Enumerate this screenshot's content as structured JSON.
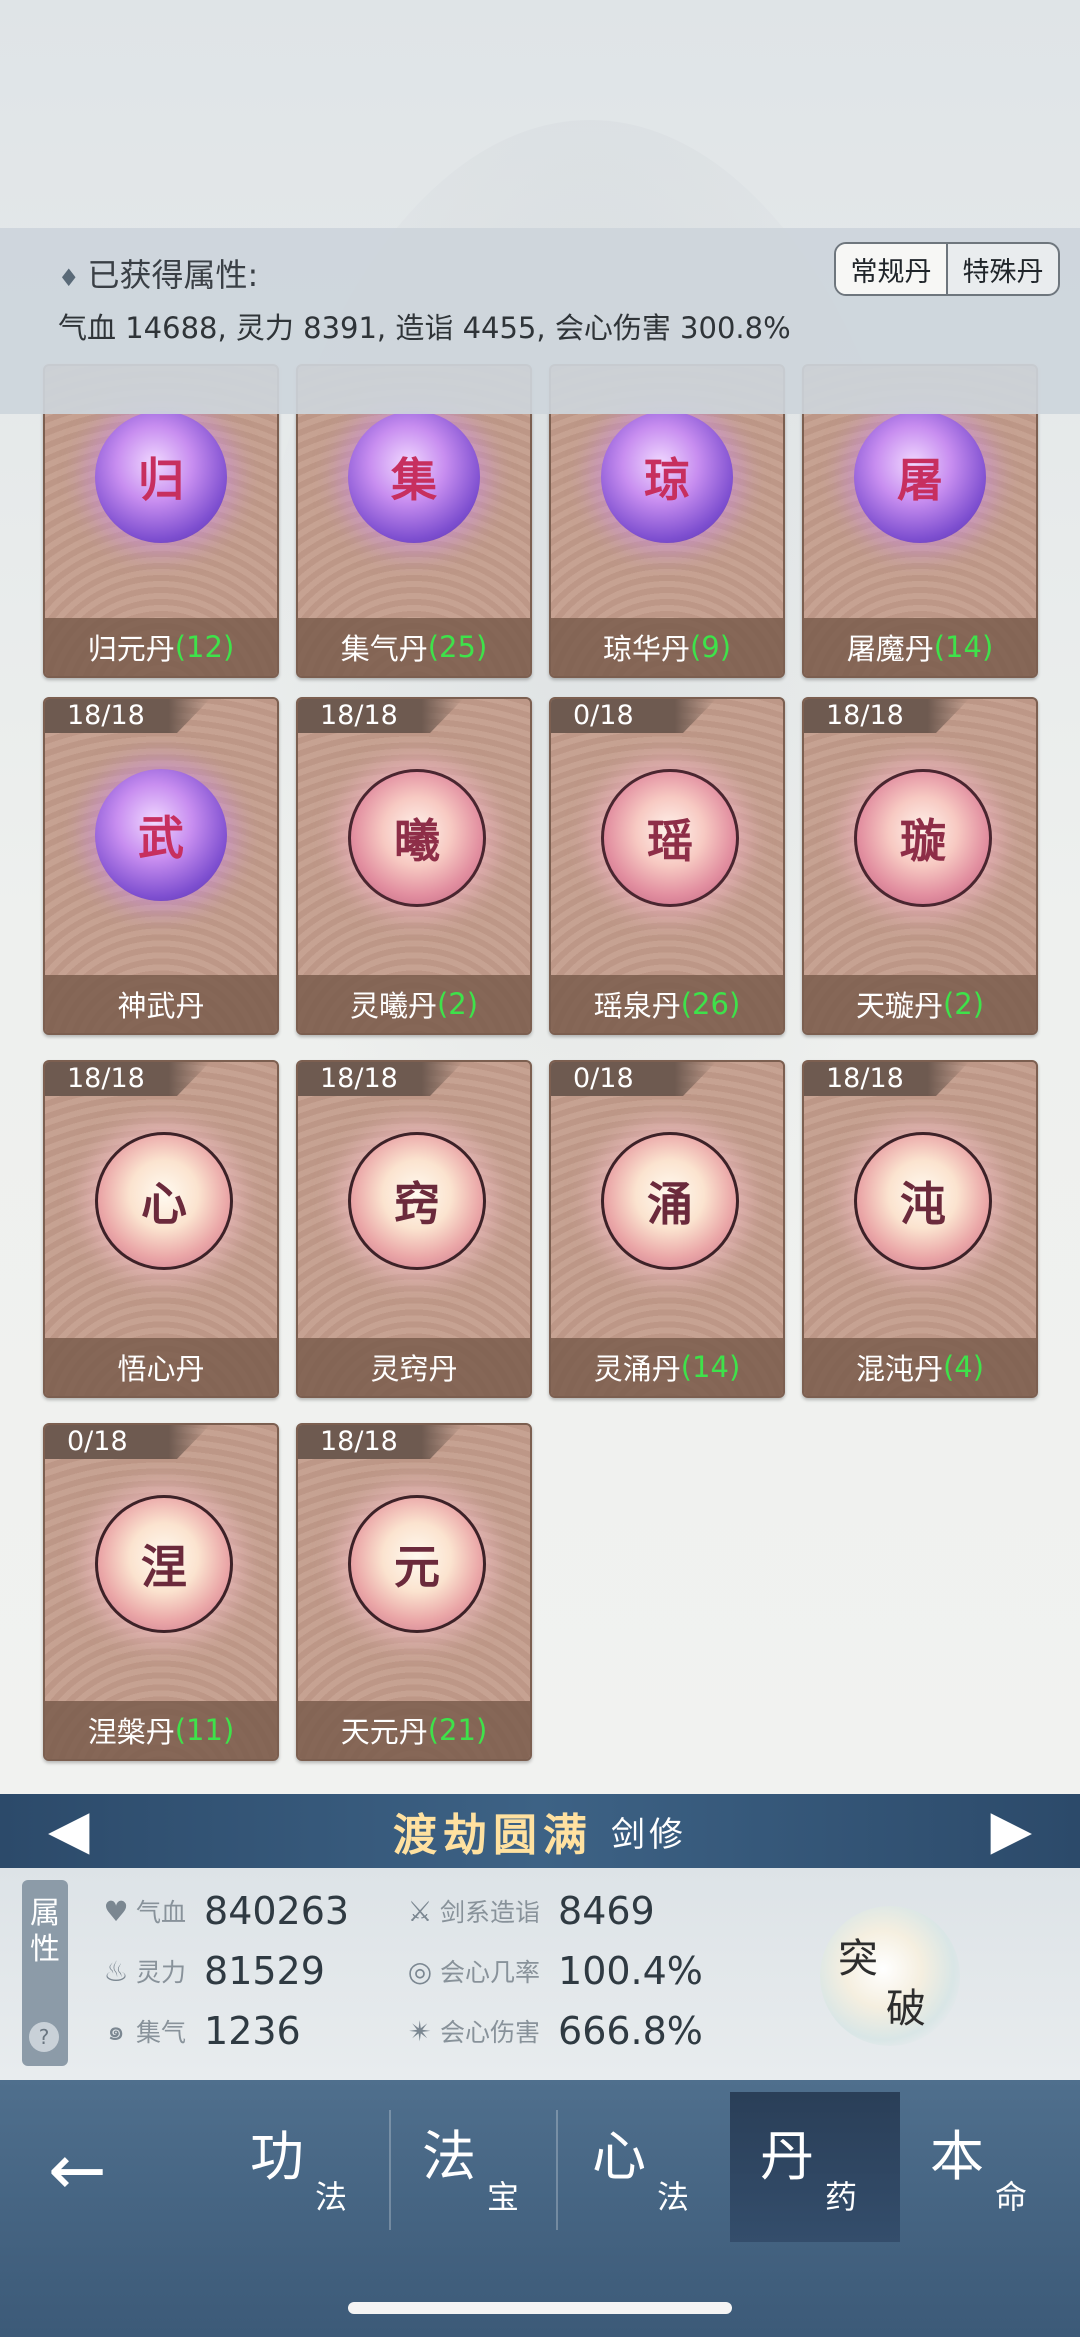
{
  "header": {
    "title": "已获得属性:",
    "stats": "气血 14688, 灵力 8391, 造诣 4455, 会心伤害 300.8%",
    "tabs": [
      "常规丹",
      "特殊丹"
    ]
  },
  "pills": [
    {
      "char": "归",
      "name": "归元丹",
      "qty": "(12)",
      "count": "",
      "style": "purple"
    },
    {
      "char": "集",
      "name": "集气丹",
      "qty": "(25)",
      "count": "",
      "style": "purple"
    },
    {
      "char": "琼",
      "name": "琼华丹",
      "qty": "(9)",
      "count": "",
      "style": "purple"
    },
    {
      "char": "屠",
      "name": "屠魔丹",
      "qty": "(14)",
      "count": "",
      "style": "purple"
    },
    {
      "char": "武",
      "name": "神武丹",
      "qty": "",
      "count": "18/18",
      "style": "purple"
    },
    {
      "char": "曦",
      "name": "灵曦丹",
      "qty": "(2)",
      "count": "18/18",
      "style": "pink"
    },
    {
      "char": "瑶",
      "name": "瑶泉丹",
      "qty": "(26)",
      "count": "0/18",
      "style": "pink"
    },
    {
      "char": "璇",
      "name": "天璇丹",
      "qty": "(2)",
      "count": "18/18",
      "style": "pink"
    },
    {
      "char": "心",
      "name": "悟心丹",
      "qty": "",
      "count": "18/18",
      "style": "pink2"
    },
    {
      "char": "窍",
      "name": "灵窍丹",
      "qty": "",
      "count": "18/18",
      "style": "pink2"
    },
    {
      "char": "涌",
      "name": "灵涌丹",
      "qty": "(14)",
      "count": "0/18",
      "style": "pink2"
    },
    {
      "char": "沌",
      "name": "混沌丹",
      "qty": "(4)",
      "count": "18/18",
      "style": "pink2"
    },
    {
      "char": "涅",
      "name": "涅槃丹",
      "qty": "(11)",
      "count": "0/18",
      "style": "pink2"
    },
    {
      "char": "元",
      "name": "天元丹",
      "qty": "(21)",
      "count": "18/18",
      "style": "pink2"
    }
  ],
  "realm": {
    "stage": "渡劫圆满",
    "class": "剑修"
  },
  "attributes": {
    "tag": [
      "属",
      "性"
    ],
    "help": "?",
    "items": [
      {
        "label": "气血",
        "value": "840263",
        "icon": "heart-icon"
      },
      {
        "label": "灵力",
        "value": "81529",
        "icon": "flame-icon"
      },
      {
        "label": "集气",
        "value": "1236",
        "icon": "swirl-icon"
      },
      {
        "label": "剑系造诣",
        "value": "8469",
        "icon": "sword-icon"
      },
      {
        "label": "会心几率",
        "value": "100.4%",
        "icon": "target-icon"
      },
      {
        "label": "会心伤害",
        "value": "666.8%",
        "icon": "burst-icon"
      }
    ]
  },
  "breakthrough": {
    "chars": [
      "突",
      "破"
    ]
  },
  "nav": {
    "back": "←",
    "items": [
      {
        "big": "功",
        "small": "法"
      },
      {
        "big": "法",
        "small": "宝"
      },
      {
        "big": "心",
        "small": "法"
      },
      {
        "big": "丹",
        "small": "药"
      },
      {
        "big": "本",
        "small": "命"
      }
    ]
  },
  "colors": {
    "qty_green": "#3ee24a",
    "realm_gold": "#ffe1a0",
    "nav_blue": "#4f6f8d"
  }
}
